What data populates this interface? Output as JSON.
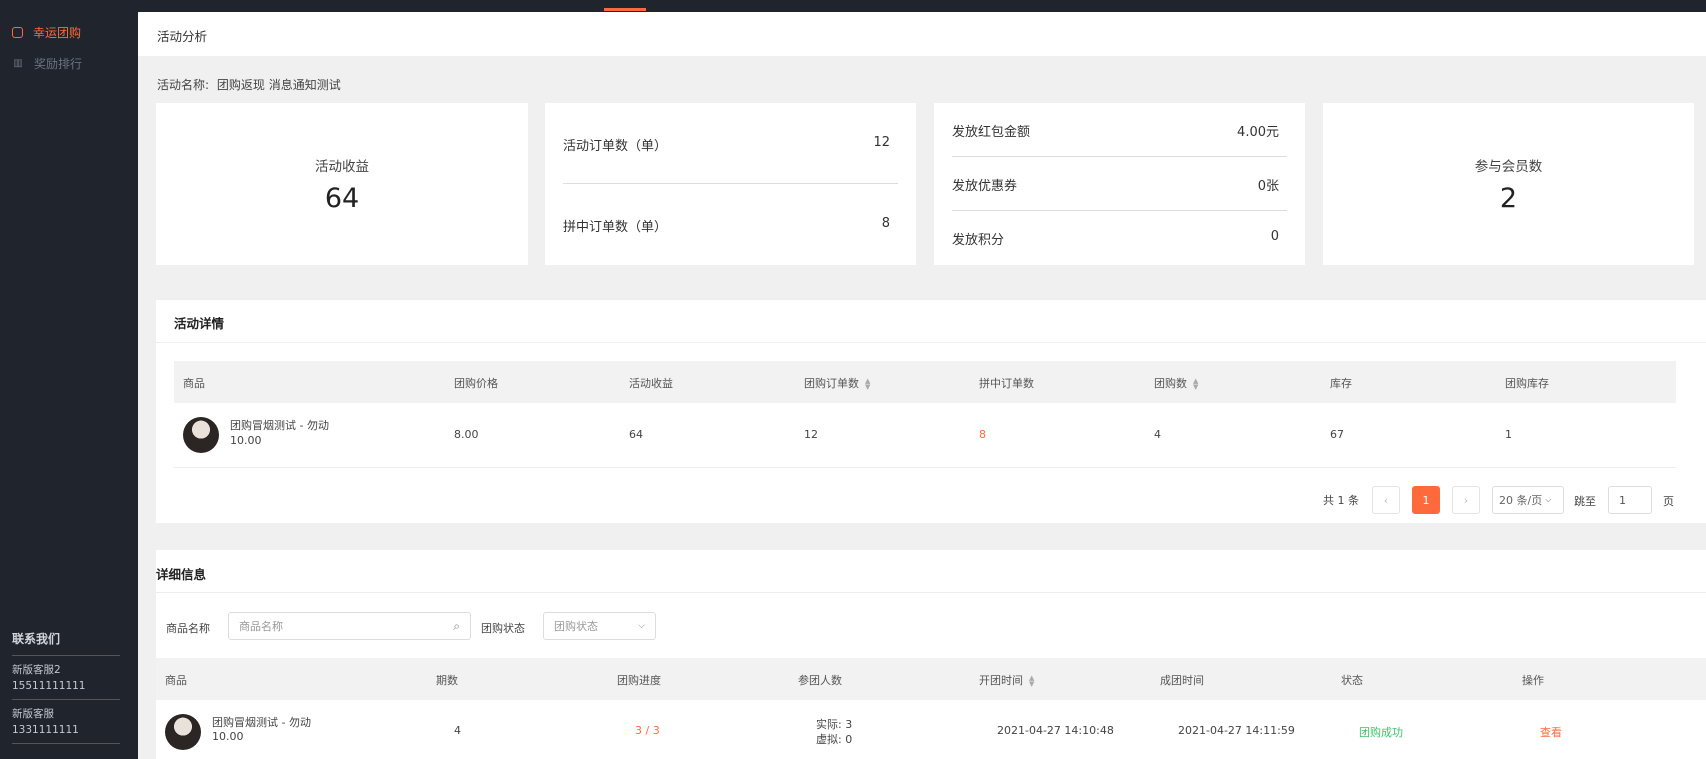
{
  "sidebar": {
    "items": [
      {
        "label": "幸运团购",
        "icon": "lucky-group-icon",
        "active": true
      },
      {
        "label": "奖励排行",
        "icon": "ranking-icon",
        "active": false
      }
    ],
    "contact": {
      "title": "联系我们",
      "services": [
        {
          "name": "新版客服2",
          "phone": "15511111111"
        },
        {
          "name": "新版客服",
          "phone": "1331111111"
        }
      ]
    }
  },
  "header": {
    "title": "活动分析"
  },
  "activity": {
    "label": "活动名称:",
    "name": "团购返现 消息通知测试"
  },
  "stats": {
    "revenue": {
      "label": "活动收益",
      "value": "64"
    },
    "orders": [
      {
        "label": "活动订单数（单）",
        "value": "12"
      },
      {
        "label": "拼中订单数（单）",
        "value": "8"
      }
    ],
    "rewards": [
      {
        "label": "发放红包金额",
        "value": "4.00元"
      },
      {
        "label": "发放优惠券",
        "value": "0张"
      },
      {
        "label": "发放积分",
        "value": "0"
      }
    ],
    "members": {
      "label": "参与会员数",
      "value": "2"
    }
  },
  "details": {
    "title": "活动详情",
    "columns": [
      "商品",
      "团购价格",
      "活动收益",
      "团购订单数",
      "拼中订单数",
      "团购数",
      "库存",
      "团购库存"
    ],
    "rows": [
      {
        "product": "团购冒烟测试 - 勿动",
        "price_sub": "10.00",
        "group_price": "8.00",
        "revenue": "64",
        "orders": "12",
        "won_orders": "8",
        "groups": "4",
        "stock": "67",
        "group_stock": "1"
      }
    ],
    "pagination": {
      "total": "共 1 条",
      "prev": "‹",
      "current": "1",
      "next": "›",
      "page_size": "20 条/页",
      "jump_label": "跳至",
      "jump_value": "1",
      "page_unit": "页"
    }
  },
  "info": {
    "title": "详细信息",
    "filters": {
      "product_label": "商品名称",
      "product_placeholder": "商品名称",
      "status_label": "团购状态",
      "status_placeholder": "团购状态"
    },
    "columns": [
      "商品",
      "期数",
      "团购进度",
      "参团人数",
      "开团时间",
      "成团时间",
      "状态",
      "操作"
    ],
    "rows": [
      {
        "product": "团购冒烟测试 - 勿动",
        "price_sub": "10.00",
        "period": "4",
        "progress": "3 / 3",
        "actual": "实际: 3",
        "virtual": "虚拟: 0",
        "open_time": "2021-04-27 14:10:48",
        "done_time": "2021-04-27 14:11:59",
        "status": "团购成功",
        "action": "查看"
      }
    ]
  },
  "colors": {
    "accent": "#ff6a3d",
    "sidebar_bg": "#1f242d",
    "success": "#3fc36b"
  }
}
